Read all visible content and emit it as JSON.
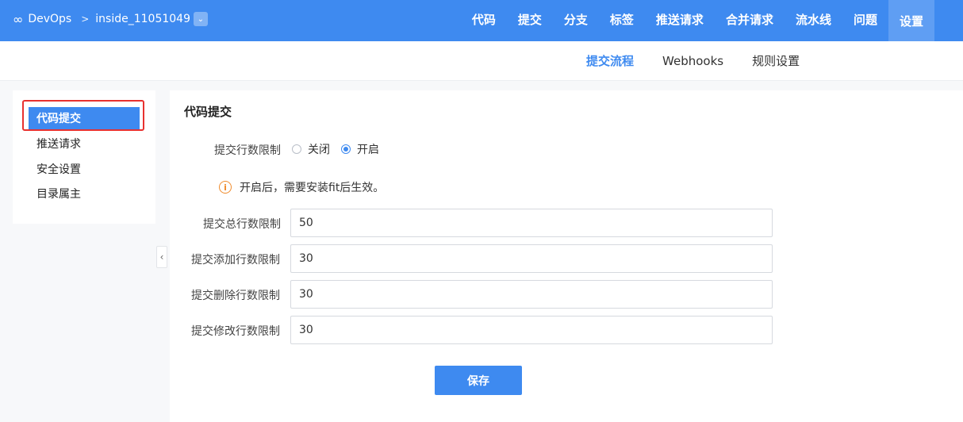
{
  "header": {
    "brand": "DevOps",
    "repo": "inside_11051049",
    "nav": [
      {
        "label": "代码",
        "active": false
      },
      {
        "label": "提交",
        "active": false
      },
      {
        "label": "分支",
        "active": false
      },
      {
        "label": "标签",
        "active": false
      },
      {
        "label": "推送请求",
        "active": false
      },
      {
        "label": "合并请求",
        "active": false
      },
      {
        "label": "流水线",
        "active": false
      },
      {
        "label": "问题",
        "active": false
      },
      {
        "label": "设置",
        "active": true
      }
    ]
  },
  "subnav": {
    "tabs": [
      {
        "label": "提交流程",
        "active": true
      },
      {
        "label": "Webhooks",
        "active": false
      },
      {
        "label": "规则设置",
        "active": false
      }
    ]
  },
  "sidebar": {
    "items": [
      {
        "label": "代码提交",
        "active": true
      },
      {
        "label": "推送请求",
        "active": false
      },
      {
        "label": "安全设置",
        "active": false
      },
      {
        "label": "目录属主",
        "active": false
      }
    ]
  },
  "main": {
    "title": "代码提交",
    "line_limit": {
      "label": "提交行数限制",
      "options": [
        {
          "label": "关闭",
          "checked": false
        },
        {
          "label": "开启",
          "checked": true
        }
      ]
    },
    "hint": "开启后，需要安装fit后生效。",
    "fields": [
      {
        "label": "提交总行数限制",
        "value": "50"
      },
      {
        "label": "提交添加行数限制",
        "value": "30"
      },
      {
        "label": "提交删除行数限制",
        "value": "30"
      },
      {
        "label": "提交修改行数限制",
        "value": "30"
      }
    ],
    "save_label": "保存"
  },
  "colors": {
    "primary": "#3e8af0",
    "highlight_border": "#e8312f",
    "warning": "#f08c2e"
  }
}
